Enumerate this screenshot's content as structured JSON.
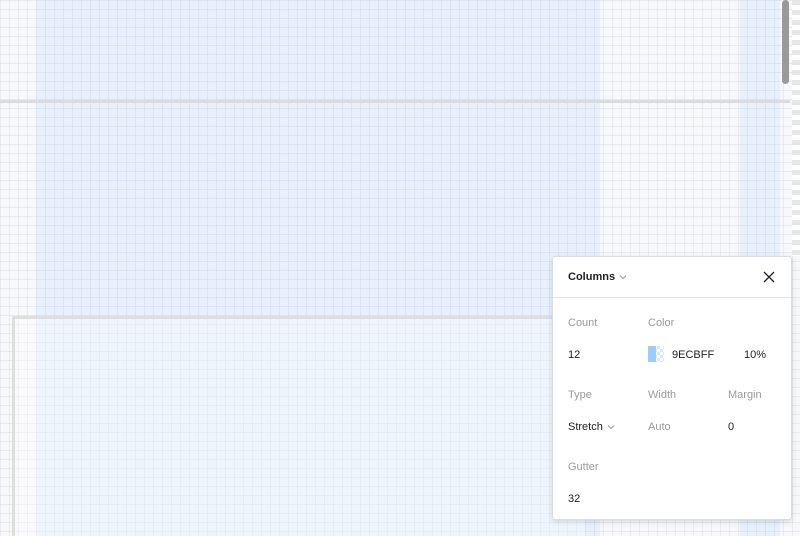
{
  "panel": {
    "title": "Columns",
    "fields": {
      "count": {
        "label": "Count",
        "value": "12"
      },
      "color": {
        "label": "Color",
        "hex": "9ECBFF",
        "opacity": "10%",
        "swatch_color": "#9ECBFF"
      },
      "type": {
        "label": "Type",
        "value": "Stretch"
      },
      "width": {
        "label": "Width",
        "value": "Auto"
      },
      "margin": {
        "label": "Margin",
        "value": "0"
      },
      "gutter": {
        "label": "Gutter",
        "value": "32"
      }
    },
    "icons": {
      "title_chevron": "chevron-down-icon",
      "close": "close-icon",
      "type_chevron": "chevron-down-icon"
    }
  },
  "colors": {
    "column_fill": "#9ECBFF",
    "accent": "#9ECBFF"
  }
}
